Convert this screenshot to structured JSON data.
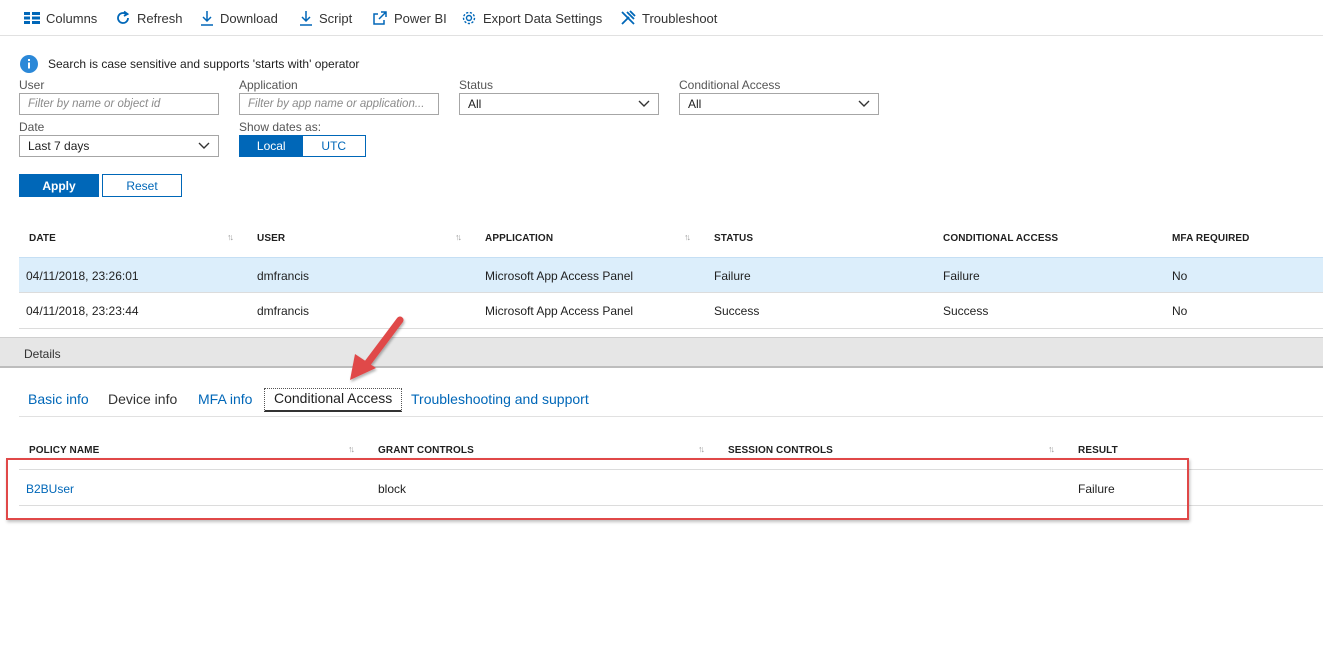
{
  "toolbar": {
    "columns": "Columns",
    "refresh": "Refresh",
    "download": "Download",
    "script": "Script",
    "power_bi": "Power BI",
    "export": "Export Data Settings",
    "troubleshoot": "Troubleshoot"
  },
  "info_text": "Search is case sensitive and supports 'starts with' operator",
  "filters": {
    "user_label": "User",
    "user_placeholder": "Filter by name or object id",
    "app_label": "Application",
    "app_placeholder": "Filter by app name or application...",
    "status_label": "Status",
    "status_value": "All",
    "ca_label": "Conditional Access",
    "ca_value": "All",
    "date_label": "Date",
    "date_value": "Last 7 days",
    "show_dates_label": "Show dates as:",
    "local": "Local",
    "utc": "UTC",
    "apply": "Apply",
    "reset": "Reset"
  },
  "signins": {
    "headers": [
      "DATE",
      "USER",
      "APPLICATION",
      "STATUS",
      "CONDITIONAL ACCESS",
      "MFA REQUIRED"
    ],
    "rows": [
      {
        "date": "04/11/2018, 23:26:01",
        "user": "dmfrancis",
        "app": "Microsoft App Access Panel",
        "status": "Failure",
        "ca": "Failure",
        "mfa": "No"
      },
      {
        "date": "04/11/2018, 23:23:44",
        "user": "dmfrancis",
        "app": "Microsoft App Access Panel",
        "status": "Success",
        "ca": "Success",
        "mfa": "No"
      }
    ]
  },
  "details": {
    "title": "Details",
    "tabs": [
      "Basic info",
      "Device info",
      "MFA info",
      "Conditional Access",
      "Troubleshooting and support"
    ]
  },
  "policy": {
    "headers": [
      "POLICY NAME",
      "GRANT CONTROLS",
      "SESSION CONTROLS",
      "RESULT"
    ],
    "rows": [
      {
        "name": "B2BUser",
        "grant": "block",
        "session": "",
        "result": "Failure"
      }
    ]
  },
  "colors": {
    "accent": "#0067b8",
    "annotation_red": "#e04848",
    "selected_row": "#dceefb"
  },
  "icons": [
    "columns-icon",
    "refresh-icon",
    "download-icon",
    "script-icon",
    "power-bi-icon",
    "gear-icon",
    "wrench-icon",
    "info-icon",
    "chevron-down-icon",
    "sort-icon"
  ]
}
